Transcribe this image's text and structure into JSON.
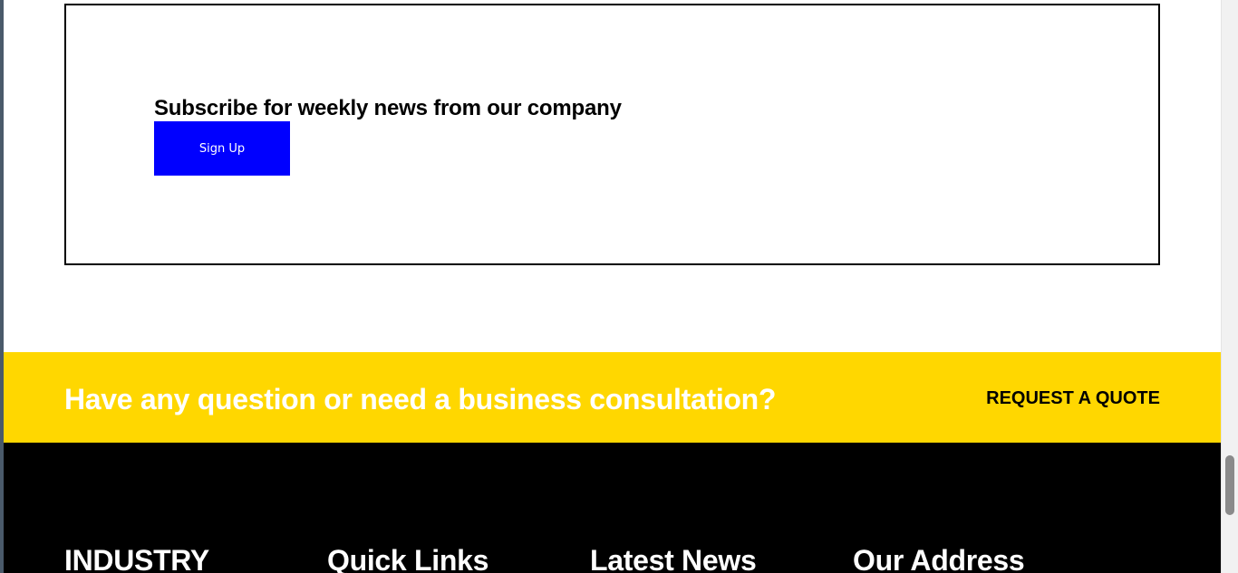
{
  "subscribe": {
    "title": "Subscribe for weekly news from our company",
    "button_label": "Sign Up"
  },
  "cta": {
    "text": "Have any question or need a business consultation?",
    "link_label": "REQUEST A QUOTE"
  },
  "footer": {
    "headings": [
      "INDUSTRY",
      "Quick Links",
      "Latest News",
      "Our Address"
    ]
  },
  "colors": {
    "signup_button": "#0000ff",
    "cta_band": "#ffd700",
    "footer_bg": "#000000"
  }
}
